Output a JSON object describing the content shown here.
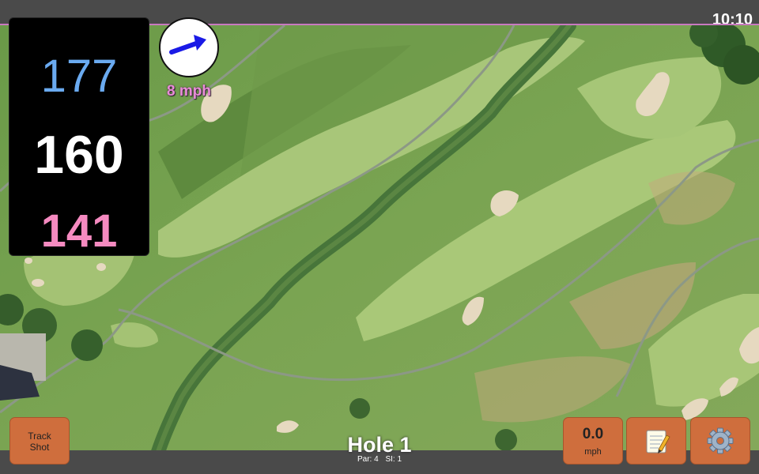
{
  "status": {
    "time": "10:10"
  },
  "distances": {
    "back": "177",
    "middle": "160",
    "front": "141"
  },
  "wind": {
    "speed_label": "8 mph",
    "arrow_icon": "arrow-right-icon",
    "arrow_color": "#1a1ae6"
  },
  "track_button": {
    "line1": "Track",
    "line2": "Shot"
  },
  "speed_button": {
    "value": "0.0",
    "unit": "mph"
  },
  "notes_button": {
    "icon": "notepad-icon"
  },
  "settings_button": {
    "icon": "gear-icon"
  },
  "hole": {
    "title": "Hole 1",
    "par": "Par: 4",
    "si": "SI: 1"
  },
  "colors": {
    "button": "#cf6e3d",
    "back": "#6aaaf0",
    "middle": "#ffffff",
    "front": "#f58ac0",
    "wind_text": "#e98cd8"
  }
}
